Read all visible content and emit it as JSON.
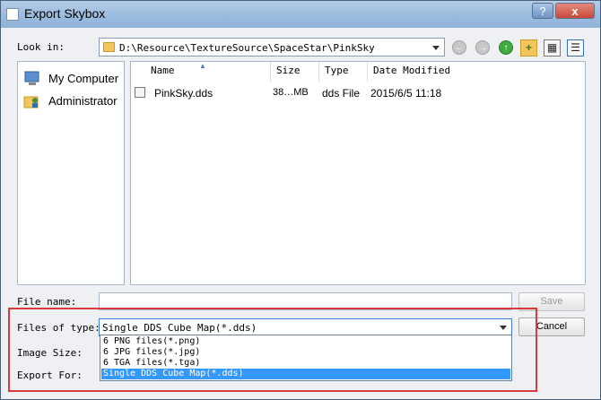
{
  "window": {
    "title": "Export Skybox",
    "help_label": "?",
    "close_label": "x"
  },
  "lookin": {
    "label": "Look in:",
    "path": "D:\\Resource\\TextureSource\\SpaceStar\\PinkSky"
  },
  "sidebar": {
    "items": [
      {
        "label": "My Computer"
      },
      {
        "label": "Administrator"
      }
    ]
  },
  "file_list": {
    "columns": [
      "Name",
      "Size",
      "Type",
      "Date Modified"
    ],
    "rows": [
      {
        "name": "PinkSky.dds",
        "size": "38…MB",
        "type": "dds File",
        "date": "2015/6/5 11:18"
      }
    ]
  },
  "bottom": {
    "file_name_label": "File name:",
    "file_name_value": "",
    "save_label": "Save",
    "files_of_type_label": "Files of type:",
    "files_of_type_value": "Single DDS Cube Map(*.dds)",
    "cancel_label": "Cancel",
    "image_size_label": "Image Size:",
    "export_for_label": "Export For:"
  },
  "dropdown_options": [
    "6 PNG files(*.png)",
    "6 JPG files(*.jpg)",
    "6 TGA files(*.tga)",
    "Single DDS Cube Map(*.dds)"
  ],
  "colors": {
    "highlight": "#3399ff",
    "annotation": "#d83b3b"
  }
}
